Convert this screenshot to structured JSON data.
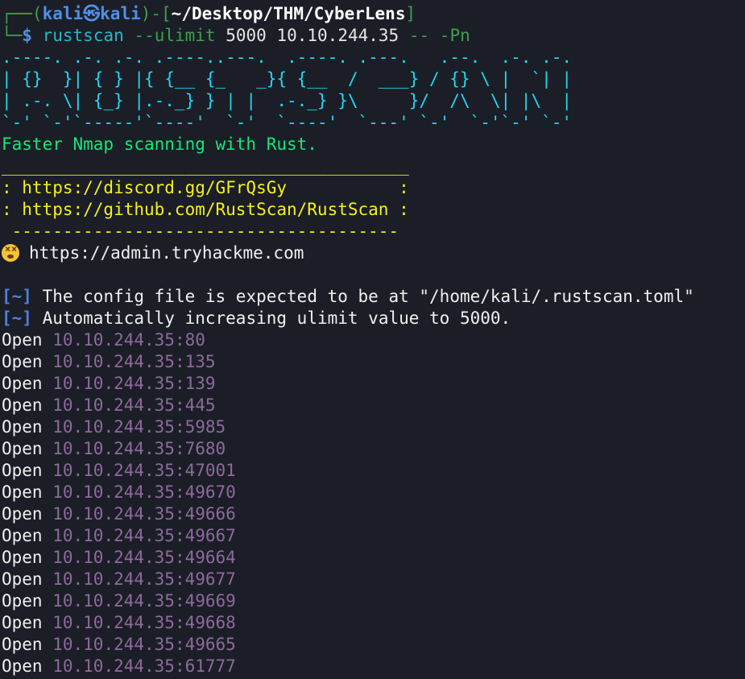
{
  "prompt": {
    "frame_top": "┌──(",
    "user": "kali",
    "at_symbol": "㉿",
    "host": "kali",
    "frame_mid": ")-[",
    "path": "~/Desktop/THM/CyberLens",
    "frame_end": "]",
    "frame_bottom": "└─",
    "dollar": "$",
    "command": "rustscan",
    "opt_ulimit": "--ulimit",
    "arg_ulimit": "5000",
    "arg_target": "10.10.244.35",
    "opt_sep": "--",
    "opt_pn": "-Pn"
  },
  "banner": [
    ".----. .-. .-. .----..---.  .----. .---.   .--.  .-. .-.",
    "| {}  }| { } |{ {__ {_   _}{ {__  /  ___} / {} \\ |  `| |",
    "| .-. \\| {_} |.-._} } | |  .-._} }\\     }/  /\\  \\| |\\  |",
    "`-' `-'`-----'`----'  `-'  `----'  `---' `-'  `-'`-' `-'"
  ],
  "tagline": "Faster Nmap scanning with Rust.",
  "links_box": {
    "top_rule": "________________________________________",
    "discord": ": https://discord.gg/GFrQsGy           :",
    "github": ": https://github.com/RustScan/RustScan :",
    "bottom_rule": " --------------------------------------"
  },
  "emoji_line": {
    "icon": "dizzy-face-icon",
    "text": "https://admin.tryhackme.com"
  },
  "info_lines": [
    {
      "bracket": "[~]",
      "text": "The config file is expected to be at \"/home/kali/.rustscan.toml\""
    },
    {
      "bracket": "[~]",
      "text": "Automatically increasing ulimit value to 5000."
    }
  ],
  "open_ports": [
    {
      "label": "Open",
      "addr": "10.10.244.35:80"
    },
    {
      "label": "Open",
      "addr": "10.10.244.35:135"
    },
    {
      "label": "Open",
      "addr": "10.10.244.35:139"
    },
    {
      "label": "Open",
      "addr": "10.10.244.35:445"
    },
    {
      "label": "Open",
      "addr": "10.10.244.35:5985"
    },
    {
      "label": "Open",
      "addr": "10.10.244.35:7680"
    },
    {
      "label": "Open",
      "addr": "10.10.244.35:47001"
    },
    {
      "label": "Open",
      "addr": "10.10.244.35:49670"
    },
    {
      "label": "Open",
      "addr": "10.10.244.35:49666"
    },
    {
      "label": "Open",
      "addr": "10.10.244.35:49667"
    },
    {
      "label": "Open",
      "addr": "10.10.244.35:49664"
    },
    {
      "label": "Open",
      "addr": "10.10.244.35:49677"
    },
    {
      "label": "Open",
      "addr": "10.10.244.35:49669"
    },
    {
      "label": "Open",
      "addr": "10.10.244.35:49668"
    },
    {
      "label": "Open",
      "addr": "10.10.244.35:49665"
    },
    {
      "label": "Open",
      "addr": "10.10.244.35:61777"
    }
  ]
}
